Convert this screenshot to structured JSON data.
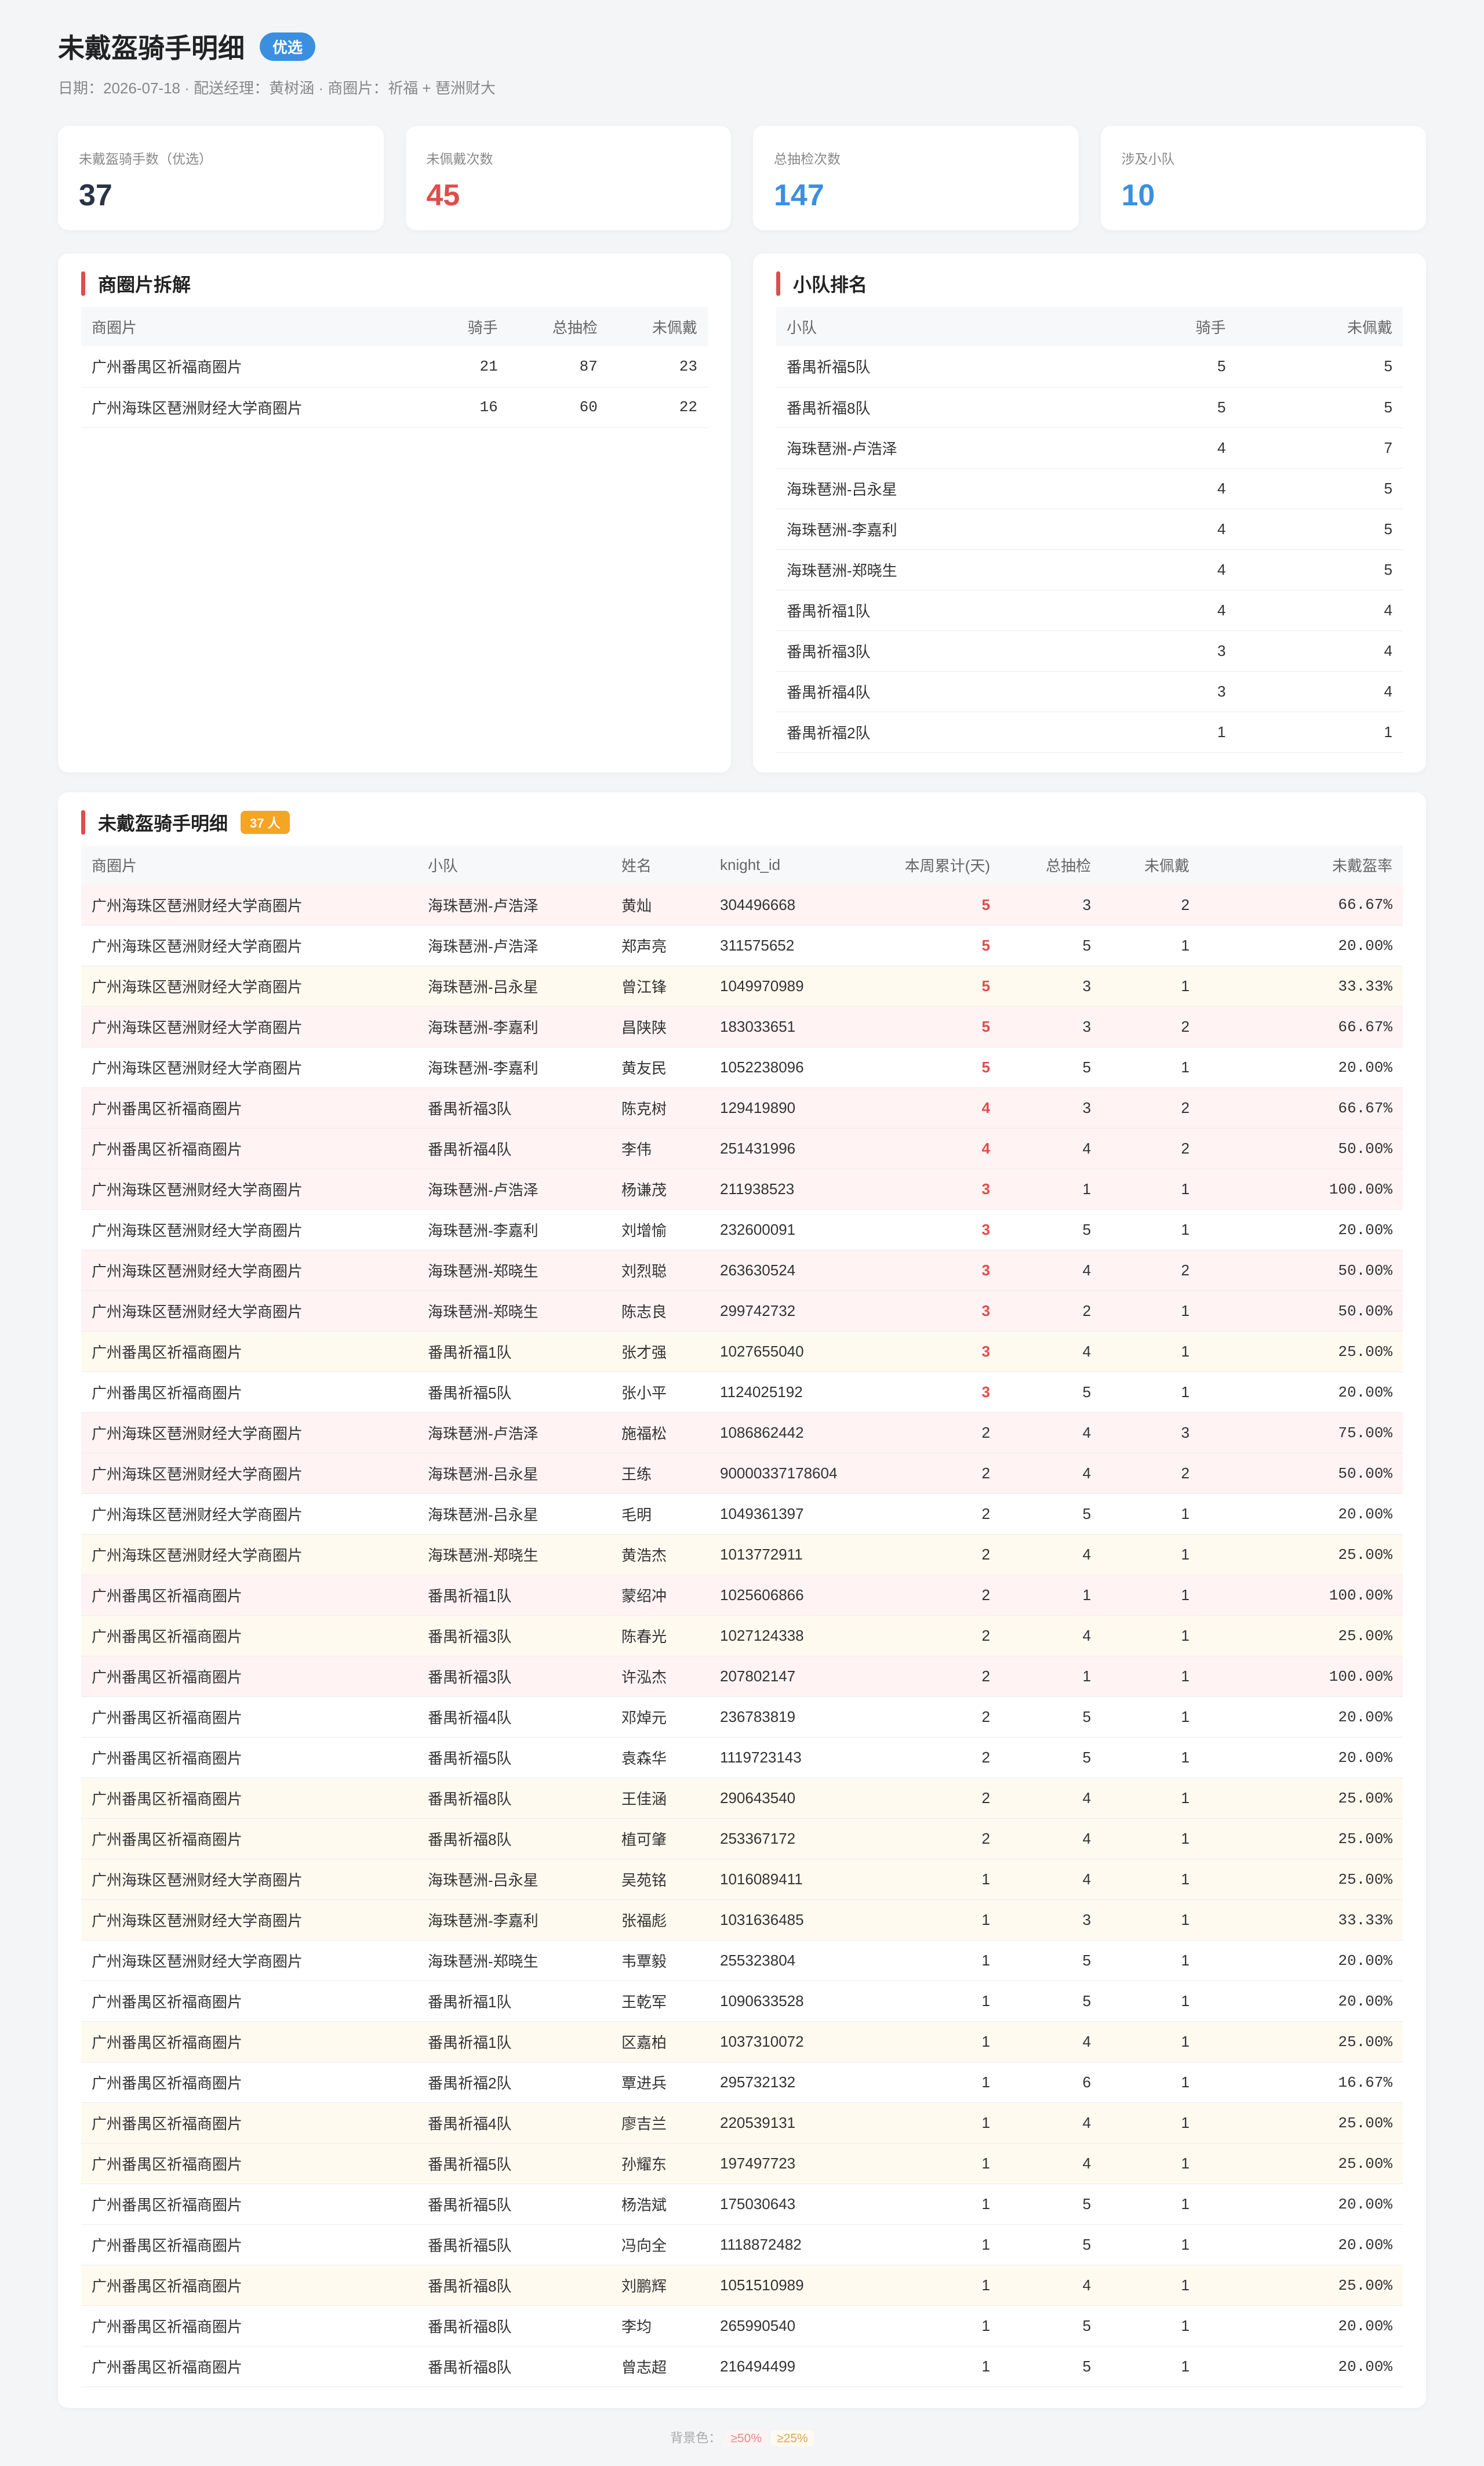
{
  "header": {
    "title": "未戴盔骑手明细",
    "badge": "优选",
    "subtitle": "日期：2026-07-18 · 配送经理：黄树涵 · 商圈片：祈福 + 琶洲财大"
  },
  "stats": [
    {
      "label": "未戴盔骑手数（优选）",
      "value": "37",
      "color": "#2b3445"
    },
    {
      "label": "未佩戴次数",
      "value": "45",
      "color": "#e04c4c"
    },
    {
      "label": "总抽检次数",
      "value": "147",
      "color": "#3b8fe0"
    },
    {
      "label": "涉及小队",
      "value": "10",
      "color": "#3b8fe0"
    }
  ],
  "district": {
    "title": "商圈片拆解",
    "headers": [
      "商圈片",
      "骑手",
      "总抽检",
      "未佩戴"
    ],
    "rows": [
      [
        "广州番禺区祈福商圈片",
        "21",
        "87",
        "23"
      ],
      [
        "广州海珠区琶洲财经大学商圈片",
        "16",
        "60",
        "22"
      ]
    ]
  },
  "ranking": {
    "title": "小队排名",
    "headers": [
      "小队",
      "骑手",
      "未佩戴"
    ],
    "rows": [
      [
        "番禺祈福5队",
        "5",
        "5"
      ],
      [
        "番禺祈福8队",
        "5",
        "5"
      ],
      [
        "海珠琶洲-卢浩泽",
        "4",
        "7"
      ],
      [
        "海珠琶洲-吕永星",
        "4",
        "5"
      ],
      [
        "海珠琶洲-李嘉利",
        "4",
        "5"
      ],
      [
        "海珠琶洲-郑晓生",
        "4",
        "5"
      ],
      [
        "番禺祈福1队",
        "4",
        "4"
      ],
      [
        "番禺祈福3队",
        "3",
        "4"
      ],
      [
        "番禺祈福4队",
        "3",
        "4"
      ],
      [
        "番禺祈福2队",
        "1",
        "1"
      ]
    ]
  },
  "detail": {
    "title": "未戴盔骑手明细",
    "count_badge": "37 人",
    "headers": [
      "商圈片",
      "小队",
      "姓名",
      "knight_id",
      "本周累计(天)",
      "总抽检",
      "未佩戴",
      "未戴盔率"
    ],
    "rows": [
      [
        "广州海珠区琶洲财经大学商圈片",
        "海珠琶洲-卢浩泽",
        "黄灿",
        "304496668",
        "5",
        "3",
        "2",
        "66.67%"
      ],
      [
        "广州海珠区琶洲财经大学商圈片",
        "海珠琶洲-卢浩泽",
        "郑声亮",
        "311575652",
        "5",
        "5",
        "1",
        "20.00%"
      ],
      [
        "广州海珠区琶洲财经大学商圈片",
        "海珠琶洲-吕永星",
        "曾江锋",
        "1049970989",
        "5",
        "3",
        "1",
        "33.33%"
      ],
      [
        "广州海珠区琶洲财经大学商圈片",
        "海珠琶洲-李嘉利",
        "昌陕陕",
        "183033651",
        "5",
        "3",
        "2",
        "66.67%"
      ],
      [
        "广州海珠区琶洲财经大学商圈片",
        "海珠琶洲-李嘉利",
        "黄友民",
        "1052238096",
        "5",
        "5",
        "1",
        "20.00%"
      ],
      [
        "广州番禺区祈福商圈片",
        "番禺祈福3队",
        "陈克树",
        "129419890",
        "4",
        "3",
        "2",
        "66.67%"
      ],
      [
        "广州番禺区祈福商圈片",
        "番禺祈福4队",
        "李伟",
        "251431996",
        "4",
        "4",
        "2",
        "50.00%"
      ],
      [
        "广州海珠区琶洲财经大学商圈片",
        "海珠琶洲-卢浩泽",
        "杨谦茂",
        "211938523",
        "3",
        "1",
        "1",
        "100.00%"
      ],
      [
        "广州海珠区琶洲财经大学商圈片",
        "海珠琶洲-李嘉利",
        "刘增愉",
        "232600091",
        "3",
        "5",
        "1",
        "20.00%"
      ],
      [
        "广州海珠区琶洲财经大学商圈片",
        "海珠琶洲-郑晓生",
        "刘烈聪",
        "263630524",
        "3",
        "4",
        "2",
        "50.00%"
      ],
      [
        "广州海珠区琶洲财经大学商圈片",
        "海珠琶洲-郑晓生",
        "陈志良",
        "299742732",
        "3",
        "2",
        "1",
        "50.00%"
      ],
      [
        "广州番禺区祈福商圈片",
        "番禺祈福1队",
        "张才强",
        "1027655040",
        "3",
        "4",
        "1",
        "25.00%"
      ],
      [
        "广州番禺区祈福商圈片",
        "番禺祈福5队",
        "张小平",
        "1124025192",
        "3",
        "5",
        "1",
        "20.00%"
      ],
      [
        "广州海珠区琶洲财经大学商圈片",
        "海珠琶洲-卢浩泽",
        "施福松",
        "1086862442",
        "2",
        "4",
        "3",
        "75.00%"
      ],
      [
        "广州海珠区琶洲财经大学商圈片",
        "海珠琶洲-吕永星",
        "王练",
        "90000337178604",
        "2",
        "4",
        "2",
        "50.00%"
      ],
      [
        "广州海珠区琶洲财经大学商圈片",
        "海珠琶洲-吕永星",
        "毛明",
        "1049361397",
        "2",
        "5",
        "1",
        "20.00%"
      ],
      [
        "广州海珠区琶洲财经大学商圈片",
        "海珠琶洲-郑晓生",
        "黄浩杰",
        "1013772911",
        "2",
        "4",
        "1",
        "25.00%"
      ],
      [
        "广州番禺区祈福商圈片",
        "番禺祈福1队",
        "蒙绍冲",
        "1025606866",
        "2",
        "1",
        "1",
        "100.00%"
      ],
      [
        "广州番禺区祈福商圈片",
        "番禺祈福3队",
        "陈春光",
        "1027124338",
        "2",
        "4",
        "1",
        "25.00%"
      ],
      [
        "广州番禺区祈福商圈片",
        "番禺祈福3队",
        "许泓杰",
        "207802147",
        "2",
        "1",
        "1",
        "100.00%"
      ],
      [
        "广州番禺区祈福商圈片",
        "番禺祈福4队",
        "邓焯元",
        "236783819",
        "2",
        "5",
        "1",
        "20.00%"
      ],
      [
        "广州番禺区祈福商圈片",
        "番禺祈福5队",
        "袁森华",
        "1119723143",
        "2",
        "5",
        "1",
        "20.00%"
      ],
      [
        "广州番禺区祈福商圈片",
        "番禺祈福8队",
        "王佳涵",
        "290643540",
        "2",
        "4",
        "1",
        "25.00%"
      ],
      [
        "广州番禺区祈福商圈片",
        "番禺祈福8队",
        "植可肇",
        "253367172",
        "2",
        "4",
        "1",
        "25.00%"
      ],
      [
        "广州海珠区琶洲财经大学商圈片",
        "海珠琶洲-吕永星",
        "吴苑铭",
        "1016089411",
        "1",
        "4",
        "1",
        "25.00%"
      ],
      [
        "广州海珠区琶洲财经大学商圈片",
        "海珠琶洲-李嘉利",
        "张福彪",
        "1031636485",
        "1",
        "3",
        "1",
        "33.33%"
      ],
      [
        "广州海珠区琶洲财经大学商圈片",
        "海珠琶洲-郑晓生",
        "韦覃毅",
        "255323804",
        "1",
        "5",
        "1",
        "20.00%"
      ],
      [
        "广州番禺区祈福商圈片",
        "番禺祈福1队",
        "王乾军",
        "1090633528",
        "1",
        "5",
        "1",
        "20.00%"
      ],
      [
        "广州番禺区祈福商圈片",
        "番禺祈福1队",
        "区嘉柏",
        "1037310072",
        "1",
        "4",
        "1",
        "25.00%"
      ],
      [
        "广州番禺区祈福商圈片",
        "番禺祈福2队",
        "覃进兵",
        "295732132",
        "1",
        "6",
        "1",
        "16.67%"
      ],
      [
        "广州番禺区祈福商圈片",
        "番禺祈福4队",
        "廖吉兰",
        "220539131",
        "1",
        "4",
        "1",
        "25.00%"
      ],
      [
        "广州番禺区祈福商圈片",
        "番禺祈福5队",
        "孙耀东",
        "197497723",
        "1",
        "4",
        "1",
        "25.00%"
      ],
      [
        "广州番禺区祈福商圈片",
        "番禺祈福5队",
        "杨浩斌",
        "175030643",
        "1",
        "5",
        "1",
        "20.00%"
      ],
      [
        "广州番禺区祈福商圈片",
        "番禺祈福5队",
        "冯向全",
        "1118872482",
        "1",
        "5",
        "1",
        "20.00%"
      ],
      [
        "广州番禺区祈福商圈片",
        "番禺祈福8队",
        "刘鹏辉",
        "1051510989",
        "1",
        "4",
        "1",
        "25.00%"
      ],
      [
        "广州番禺区祈福商圈片",
        "番禺祈福8队",
        "李均",
        "265990540",
        "1",
        "5",
        "1",
        "20.00%"
      ],
      [
        "广州番禺区祈福商圈片",
        "番禺祈福8队",
        "曾志超",
        "216494499",
        "1",
        "5",
        "1",
        "20.00%"
      ]
    ]
  },
  "legend": {
    "label": "背景色：",
    "high": "≥50%",
    "mid": "≥25%"
  },
  "colors": {
    "accent_red": "#e04c4c",
    "accent_blue": "#3b8fe0",
    "badge_orange": "#f5a524",
    "row_high_bg": "#fff3f3",
    "row_mid_bg": "#fffaf0"
  }
}
